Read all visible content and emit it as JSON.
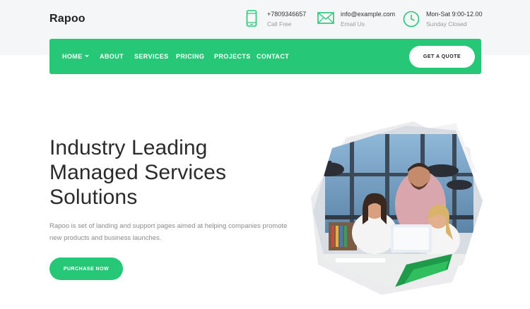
{
  "brand": {
    "name": "Rapoo"
  },
  "contacts": [
    {
      "icon": "phone-icon",
      "line1": "+7809346657",
      "line2": "Call Free"
    },
    {
      "icon": "mail-icon",
      "line1": "info@example.com",
      "line2": "Email Us"
    },
    {
      "icon": "clock-icon",
      "line1": "Mon-Sat 9:00-12.00",
      "line2": "Sunday Closed"
    }
  ],
  "nav": {
    "items": [
      {
        "label": "HOME",
        "dropdown": true
      },
      {
        "label": "ABOUT"
      },
      {
        "label": "SERVICES"
      },
      {
        "label": "PRICING"
      },
      {
        "label": "PROJECTS"
      },
      {
        "label": "CONTACT"
      }
    ],
    "cta": "GET A QUOTE"
  },
  "hero": {
    "title_lines": [
      "Industry Leading",
      "Managed Services",
      "Solutions"
    ],
    "description": "Rapoo is set of landing and support pages aimed at helping companies promote new products and business launches.",
    "button": "PURCHASE NOW"
  },
  "colors": {
    "accent": "#26c777",
    "topbar": "#f5f6f8",
    "text": "#2b2b2b",
    "muted": "#8a8a8a"
  }
}
